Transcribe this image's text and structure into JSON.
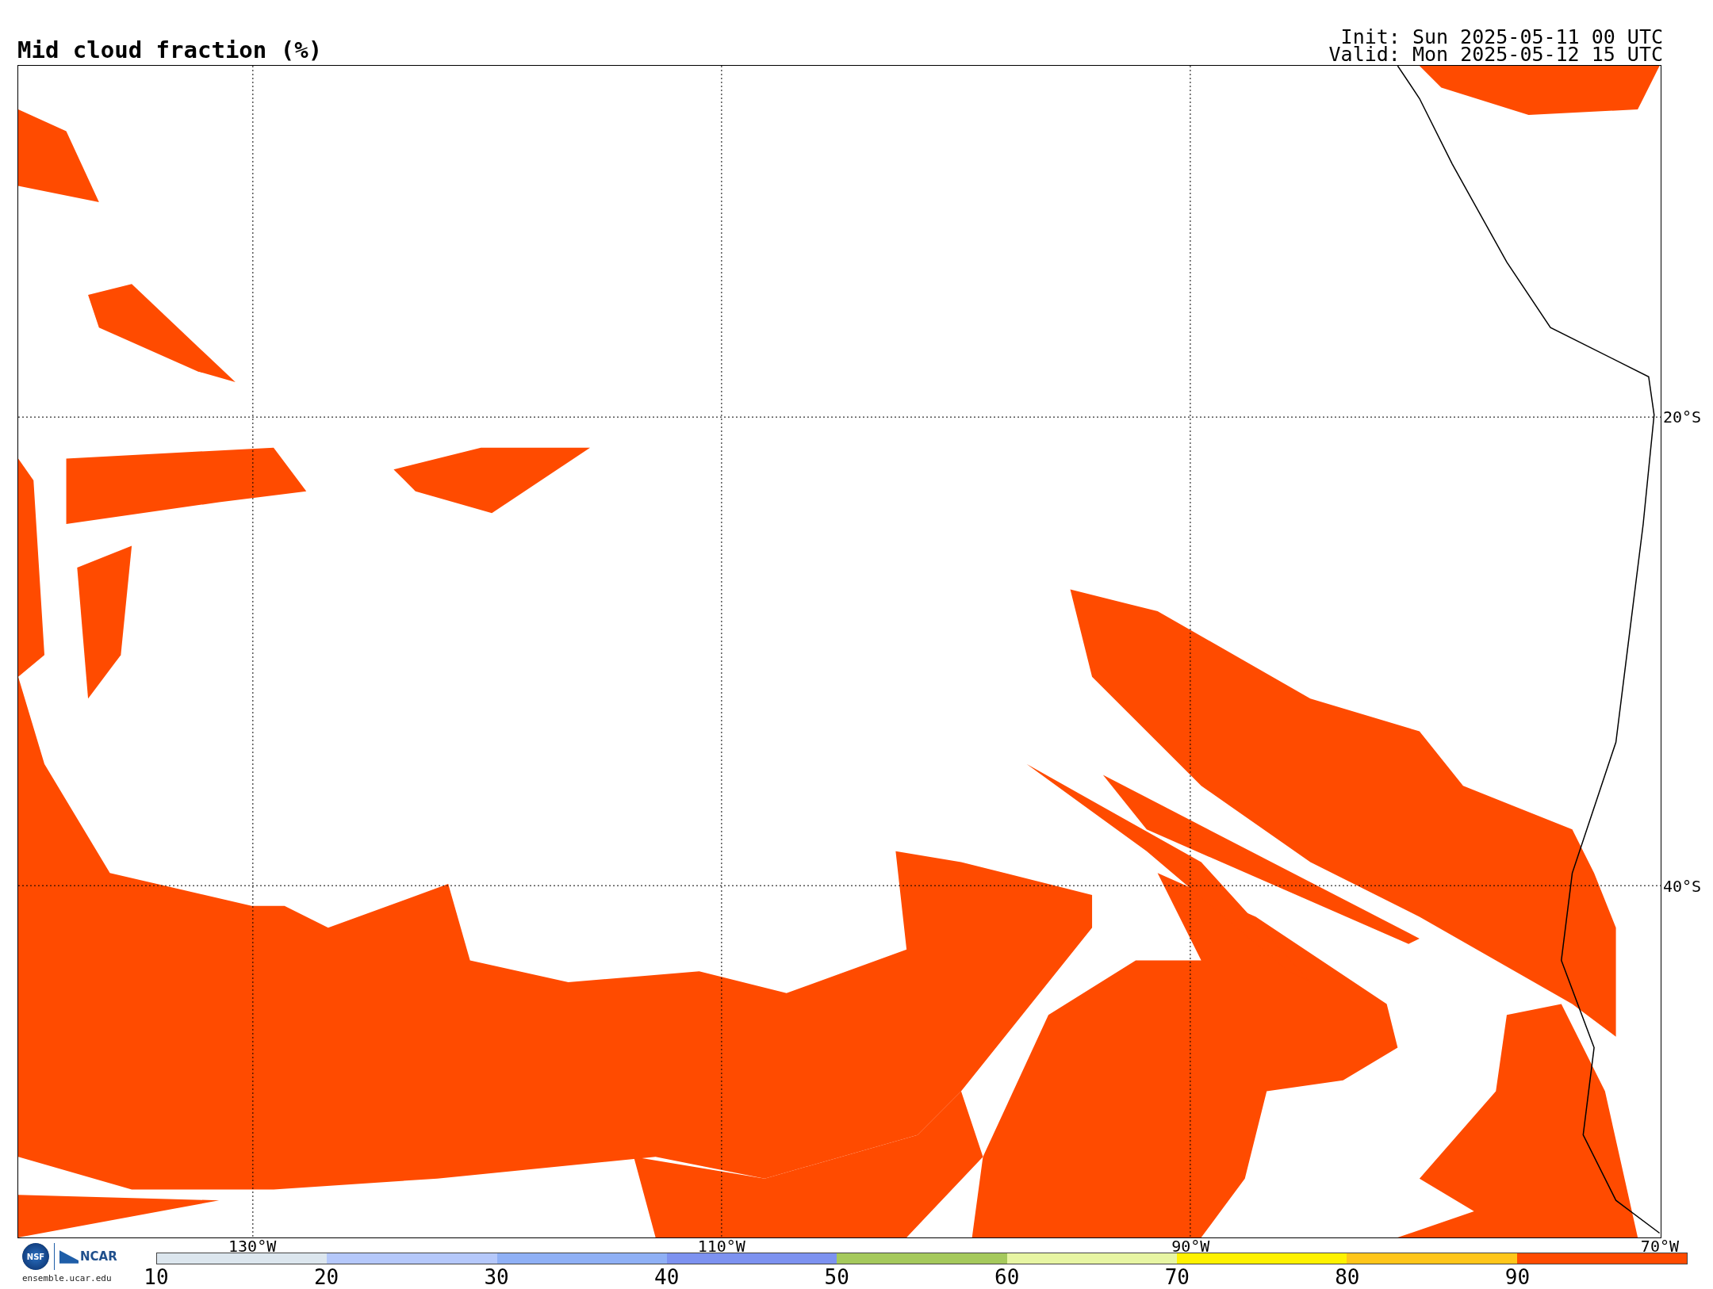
{
  "title": "Mid cloud fraction (%)",
  "init": "Init: Sun 2025-05-11 00 UTC",
  "valid": "Valid: Mon 2025-05-12 15 UTC",
  "lat_labels": [
    "20°S",
    "40°S"
  ],
  "lon_labels": [
    "130°W",
    "110°W",
    "90°W",
    "70°W"
  ],
  "logos": {
    "nsf": "NSF",
    "ncar": "NCAR",
    "url": "ensemble.ucar.edu"
  },
  "colorbar": {
    "bins": [
      {
        "color": "#dce6ee"
      },
      {
        "color": "#b5c8fa"
      },
      {
        "color": "#8fb0f5"
      },
      {
        "color": "#7d92f0"
      },
      {
        "color": "#a5c95c"
      },
      {
        "color": "#e7f5a3"
      },
      {
        "color": "#fff200"
      },
      {
        "color": "#ffc61a"
      },
      {
        "color": "#ff4b00"
      }
    ],
    "ticks": [
      "10",
      "20",
      "30",
      "40",
      "50",
      "60",
      "70",
      "80",
      "90"
    ]
  }
}
